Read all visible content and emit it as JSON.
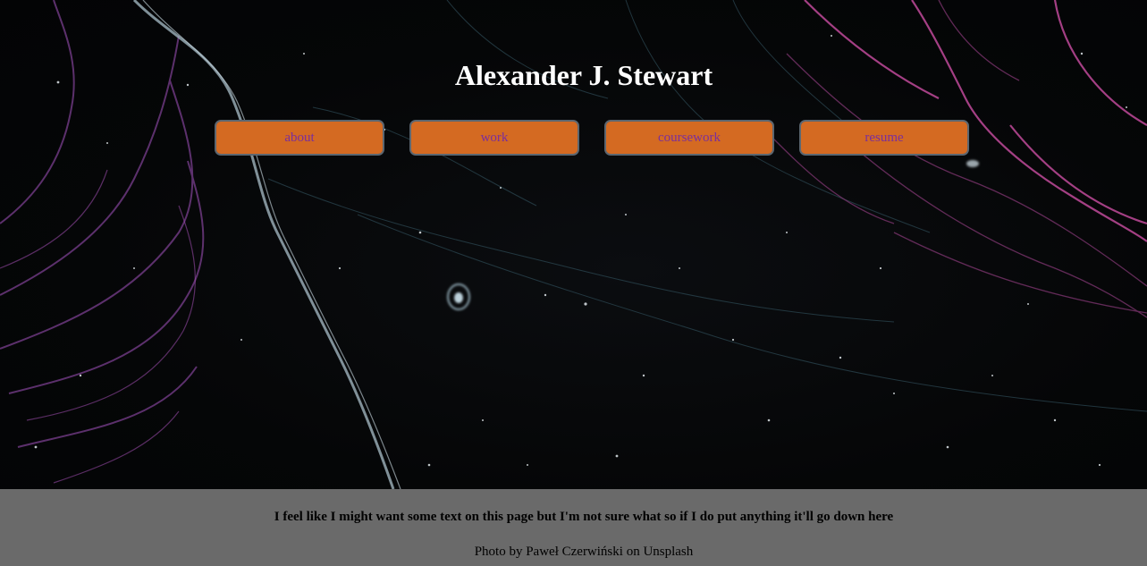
{
  "header": {
    "title": "Alexander J. Stewart"
  },
  "nav": {
    "items": [
      {
        "label": "about"
      },
      {
        "label": "work"
      },
      {
        "label": "coursework"
      },
      {
        "label": "resume"
      }
    ]
  },
  "footer": {
    "note": "I feel like I might want some text on this page but I'm not sure what so if I do put anything it'll go down here",
    "credit": "Photo by Paweł Czerwiński on Unsplash"
  },
  "colors": {
    "button_bg": "#d46a22",
    "button_text": "#7a2e9c",
    "button_border": "#5b6670",
    "footer_bg": "#6a6a6a",
    "title": "#ffffff"
  }
}
